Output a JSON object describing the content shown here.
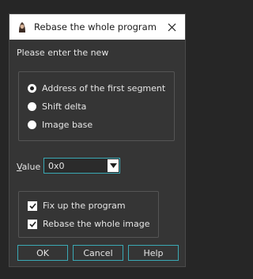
{
  "window": {
    "title": "Rebase the whole program",
    "app_icon": "ida-app-icon",
    "close_icon": "close-icon"
  },
  "prompt": "Please enter the new",
  "options": [
    {
      "label": "Address of the first segment",
      "selected": true
    },
    {
      "label": "Shift delta",
      "selected": false
    },
    {
      "label": "Image base",
      "selected": false
    }
  ],
  "value": {
    "label_mnemonic": "V",
    "label_rest": "alue",
    "input": "0x0"
  },
  "checkboxes": [
    {
      "label": "Fix up the program",
      "checked": true
    },
    {
      "label": "Rebase the whole image",
      "checked": true
    }
  ],
  "buttons": {
    "ok": "OK",
    "cancel": "Cancel",
    "help": "Help"
  },
  "colors": {
    "accent": "#3aa9b5",
    "background": "#353535",
    "titlebar": "#ffffff"
  }
}
